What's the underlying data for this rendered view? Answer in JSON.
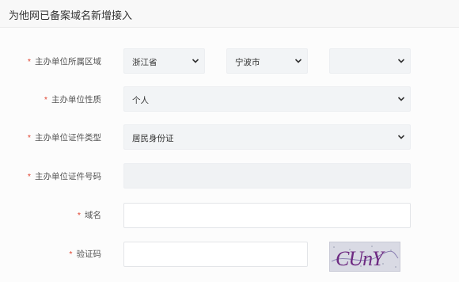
{
  "header": {
    "title": "为他网已备案域名新增接入"
  },
  "form": {
    "region": {
      "label": "主办单位所属区域",
      "province": "浙江省",
      "city": "宁波市",
      "district": ""
    },
    "nature": {
      "label": "主办单位性质",
      "value": "个人"
    },
    "cert_type": {
      "label": "主办单位证件类型",
      "value": "居民身份证"
    },
    "cert_no": {
      "label": "主办单位证件号码",
      "value": ""
    },
    "domain": {
      "label": "域名",
      "value": ""
    },
    "captcha": {
      "label": "验证码",
      "value": "",
      "image_text": "CUnY"
    }
  },
  "required_mark": "*",
  "colors": {
    "required": "#e0422f",
    "select_bg": "#f2f4f6"
  },
  "icons": {
    "select_arrow": "chevron-down-icon"
  }
}
